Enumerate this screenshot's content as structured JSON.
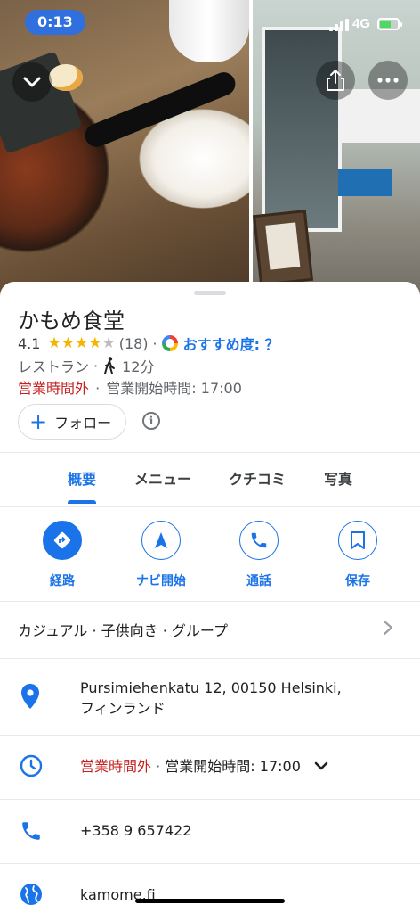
{
  "status_bar": {
    "time": "0:13",
    "network": "4G"
  },
  "place": {
    "name": "かもめ食堂",
    "rating": "4.1",
    "rating_value": 4.1,
    "review_count": "(18)",
    "recommend_label": "おすすめ度: ？",
    "category": "レストラン",
    "walk_time": "12分",
    "status_closed": "営業時間外",
    "opens_text": "営業開始時間: 17:00"
  },
  "follow": {
    "label": "フォロー"
  },
  "tabs": [
    {
      "label": "概要",
      "active": true
    },
    {
      "label": "メニュー",
      "active": false
    },
    {
      "label": "クチコミ",
      "active": false
    },
    {
      "label": "写真",
      "active": false
    }
  ],
  "actions": [
    {
      "label": "経路",
      "icon": "directions-icon"
    },
    {
      "label": "ナビ開始",
      "icon": "navigation-icon"
    },
    {
      "label": "通話",
      "icon": "phone-icon"
    },
    {
      "label": "保存",
      "icon": "bookmark-icon"
    }
  ],
  "attributes": {
    "text": "カジュアル · 子供向き · グループ"
  },
  "address": {
    "line1": "Pursimiehenkatu 12, 00150 Helsinki,",
    "line2": "フィンランド"
  },
  "hours": {
    "status": "営業時間外",
    "detail": "営業開始時間: 17:00"
  },
  "phone": {
    "number": "+358 9 657422"
  },
  "website": {
    "url": "kamome.fi"
  },
  "colors": {
    "accent": "#1a73e8",
    "closed": "#c5221f",
    "star": "#f4b400",
    "time_pill": "#2f6fde"
  }
}
